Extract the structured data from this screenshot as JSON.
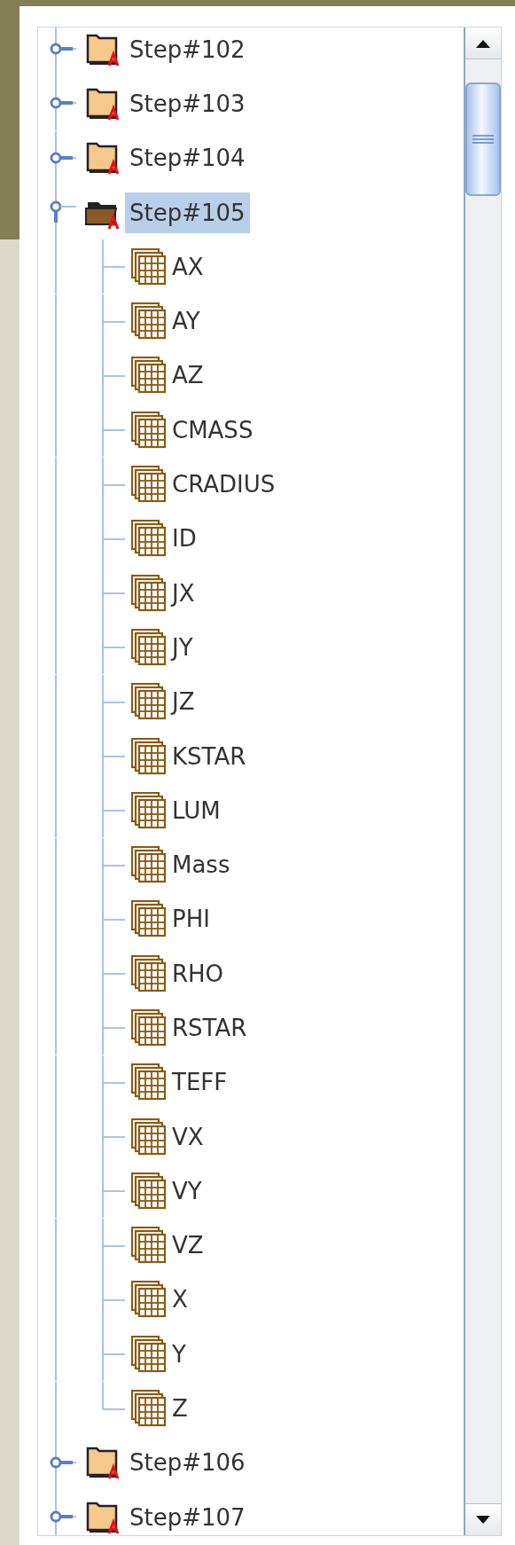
{
  "tree": {
    "items": [
      {
        "label": "Step#102",
        "expanded": false,
        "selected": false
      },
      {
        "label": "Step#103",
        "expanded": false,
        "selected": false
      },
      {
        "label": "Step#104",
        "expanded": false,
        "selected": false
      },
      {
        "label": "Step#105",
        "expanded": true,
        "selected": true,
        "children": [
          {
            "label": "AX"
          },
          {
            "label": "AY"
          },
          {
            "label": "AZ"
          },
          {
            "label": "CMASS"
          },
          {
            "label": "CRADIUS"
          },
          {
            "label": "ID"
          },
          {
            "label": "JX"
          },
          {
            "label": "JY"
          },
          {
            "label": "JZ"
          },
          {
            "label": "KSTAR"
          },
          {
            "label": "LUM"
          },
          {
            "label": "Mass"
          },
          {
            "label": "PHI"
          },
          {
            "label": "RHO"
          },
          {
            "label": "RSTAR"
          },
          {
            "label": "TEFF"
          },
          {
            "label": "VX"
          },
          {
            "label": "VY"
          },
          {
            "label": "VZ"
          },
          {
            "label": "X"
          },
          {
            "label": "Y"
          },
          {
            "label": "Z"
          }
        ]
      },
      {
        "label": "Step#106",
        "expanded": false,
        "selected": false
      },
      {
        "label": "Step#107",
        "expanded": false,
        "selected": false
      }
    ]
  }
}
